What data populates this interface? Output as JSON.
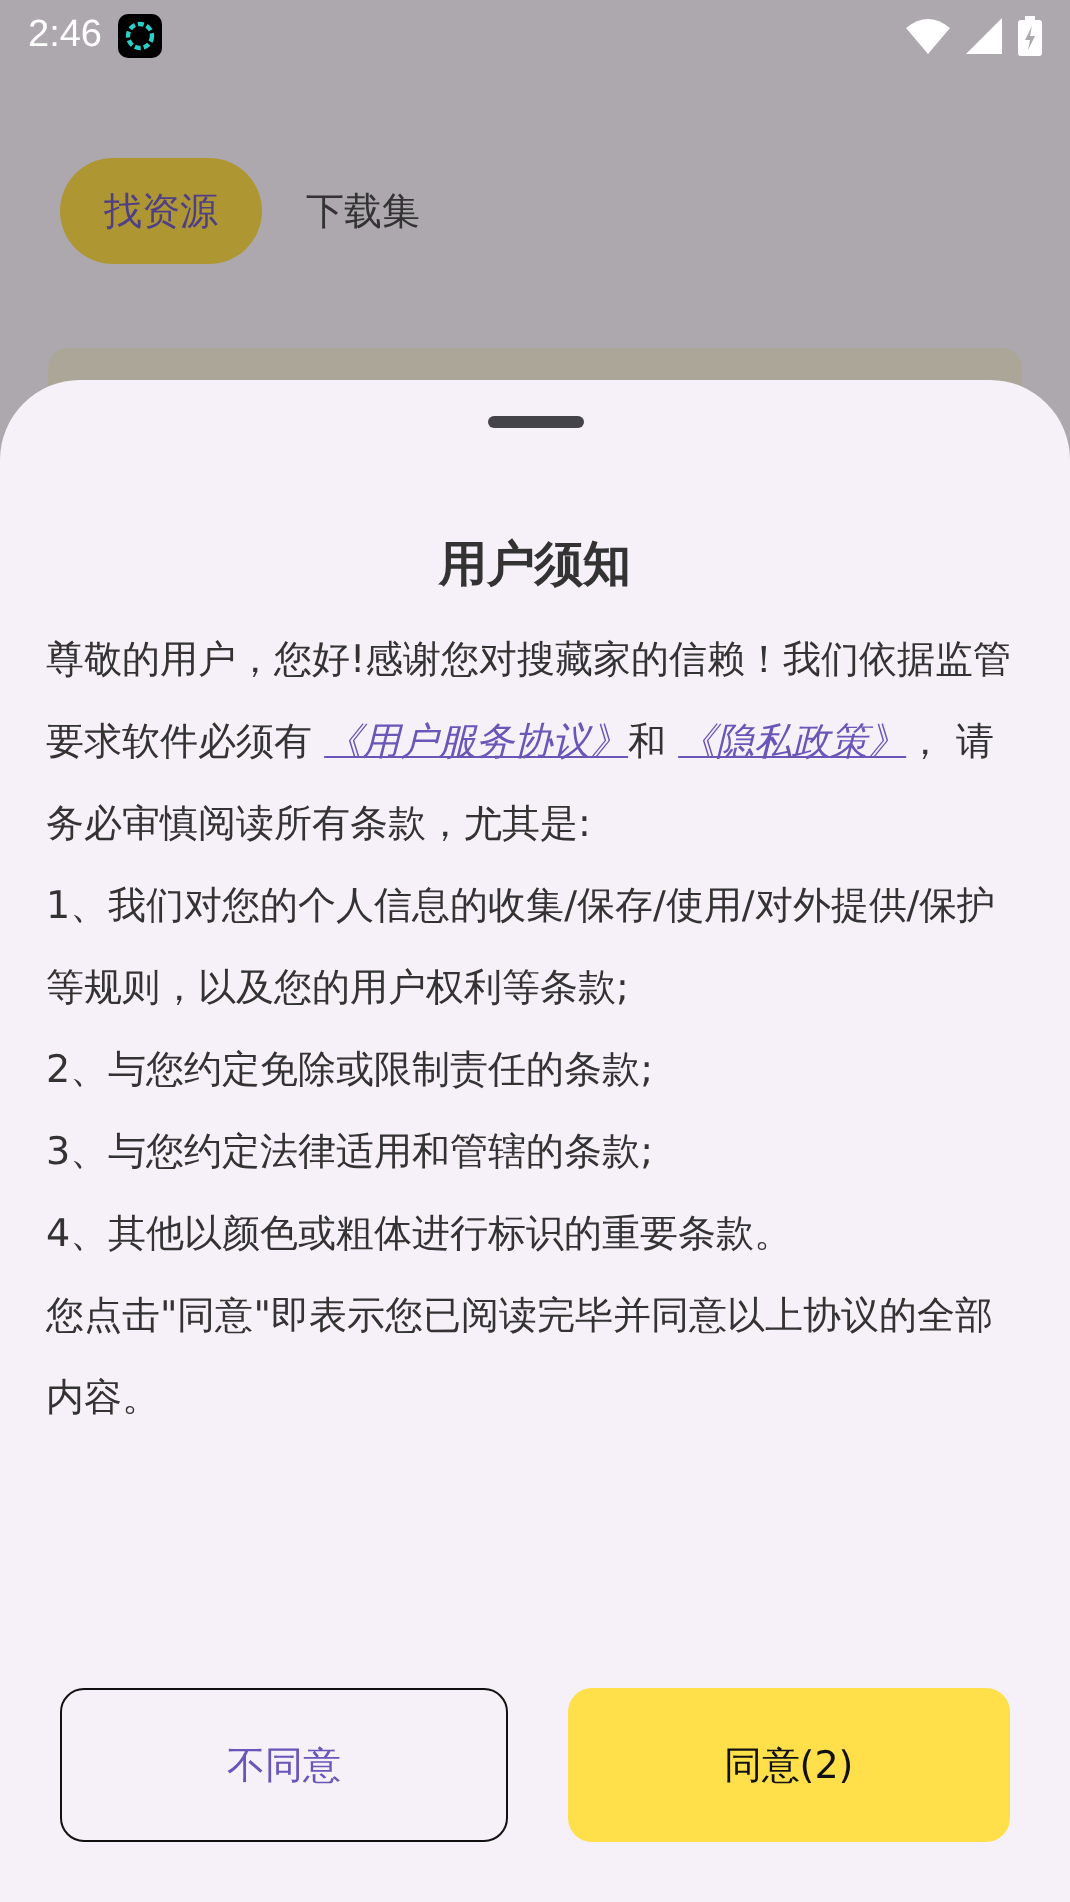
{
  "status_bar": {
    "time": "2:46"
  },
  "tabs": [
    {
      "label": "找资源",
      "selected": true
    },
    {
      "label": "下载集",
      "selected": false
    }
  ],
  "dialog": {
    "title": "用户须知",
    "intro": [
      {
        "kind": "text",
        "text": "尊敬的用户，您好!感谢您对搜藏家的信赖！我们依据监管要求软件必须有 "
      },
      {
        "kind": "link",
        "text": "《用户服务协议》"
      },
      {
        "kind": "text",
        "text": "和 "
      },
      {
        "kind": "link",
        "text": "《隐私政策》"
      },
      {
        "kind": "text",
        "text": "， 请务必审慎阅读所有条款，尤其是:"
      }
    ],
    "paragraphs": [
      "1、我们对您的个人信息的收集/保存/使用/对外提供/保护等规则，以及您的用户权利等条款;",
      "2、与您约定免除或限制责任的条款;",
      "3、与您约定法律适用和管辖的条款;",
      "4、其他以颜色或粗体进行标识的重要条款。",
      "您点击\"同意\"即表示您已阅读完毕并同意以上协议的全部内容。"
    ],
    "buttons": [
      {
        "label": "不同意",
        "kind": "outline"
      },
      {
        "label": "同意(2)",
        "kind": "primary"
      }
    ]
  }
}
